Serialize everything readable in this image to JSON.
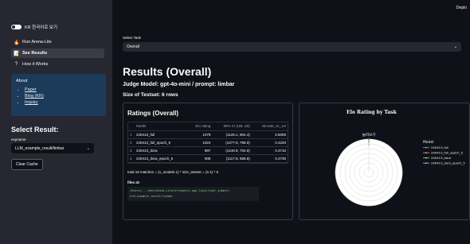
{
  "sidebar": {
    "toggle_label": "KR 한국어로 보기",
    "nav": [
      {
        "icon": "fire-icon",
        "glyph": "🔥",
        "label": "Run Arena-Lite",
        "active": false
      },
      {
        "icon": "chart-icon",
        "glyph": "📝",
        "label": "See Results",
        "active": true
      },
      {
        "icon": "question-icon",
        "glyph": "?",
        "label": "How it Works",
        "active": false
      }
    ],
    "about": {
      "title": "About",
      "links": [
        "Paper",
        "Blog (KR)",
        "Inquiry"
      ]
    },
    "select_result_title": "Select Result:",
    "expname_label": "expname",
    "expname_value": "LLM_example_result/limbar",
    "clear_cache_label": "Clear Cache"
  },
  "header": {
    "deploy_label": "Deplo"
  },
  "main": {
    "task_label": "Select Task",
    "task_value": "Overall",
    "results_title": "Results (Overall)",
    "judge_model": "Judge Model: gpt-4o-mini / prompt: limbar",
    "testset_size": "Size of Testset: 6 rows"
  },
  "ratings": {
    "title": "Ratings (Overall)",
    "columns": [
      "",
      "Model",
      "Elo rating",
      "95% CI (UB, LB)",
      "winrate_vs_1st"
    ],
    "rows": [
      [
        "1",
        "240413_full",
        "1079",
        "(1126.1, 904.4)",
        "0.5000"
      ],
      [
        "2",
        "240413_full_epoch_5",
        "1024",
        "(1277.0, 796.0)",
        "0.4220"
      ],
      [
        "3",
        "240413_dora",
        "987",
        "(1240.9, 704.9)",
        "0.3710"
      ],
      [
        "4",
        "240413_dora_epoch_5",
        "908",
        "(1117.8, 585.8)",
        "0.2730"
      ]
    ],
    "total_text": "total 18 matches = (n_models-1) * size_testset = (4-1) * 6",
    "files_at_label": "files at:",
    "files_path_line1": "/Users/.../dev/Arena-Lite/streamlit_app_local/user_submit/",
    "files_path_line2": "LLM_example_result/limbar"
  },
  "chart_panel": {
    "title": "Elo Rating by Task",
    "axis_label": "놀려보기",
    "legend_title": "Model",
    "legend": [
      {
        "name": "240413_full",
        "color": "#6ea6e0"
      },
      {
        "name": "240413_full_epoch_5",
        "color": "#f0a35a"
      },
      {
        "name": "240413_dora",
        "color": "#9fd18b"
      },
      {
        "name": "240413_dora_epoch_5",
        "color": "#c9a7e8"
      }
    ]
  },
  "chart_data": {
    "type": "radar",
    "title": "Elo Rating by Task",
    "axes": [
      "놀려보기"
    ],
    "series": [
      {
        "name": "240413_full",
        "values": [
          1079
        ]
      },
      {
        "name": "240413_full_epoch_5",
        "values": [
          1024
        ]
      },
      {
        "name": "240413_dora",
        "values": [
          987
        ]
      },
      {
        "name": "240413_dora_epoch_5",
        "values": [
          908
        ]
      }
    ],
    "radial_range": [
      0,
      1100
    ],
    "grid": true,
    "legend_position": "right"
  }
}
